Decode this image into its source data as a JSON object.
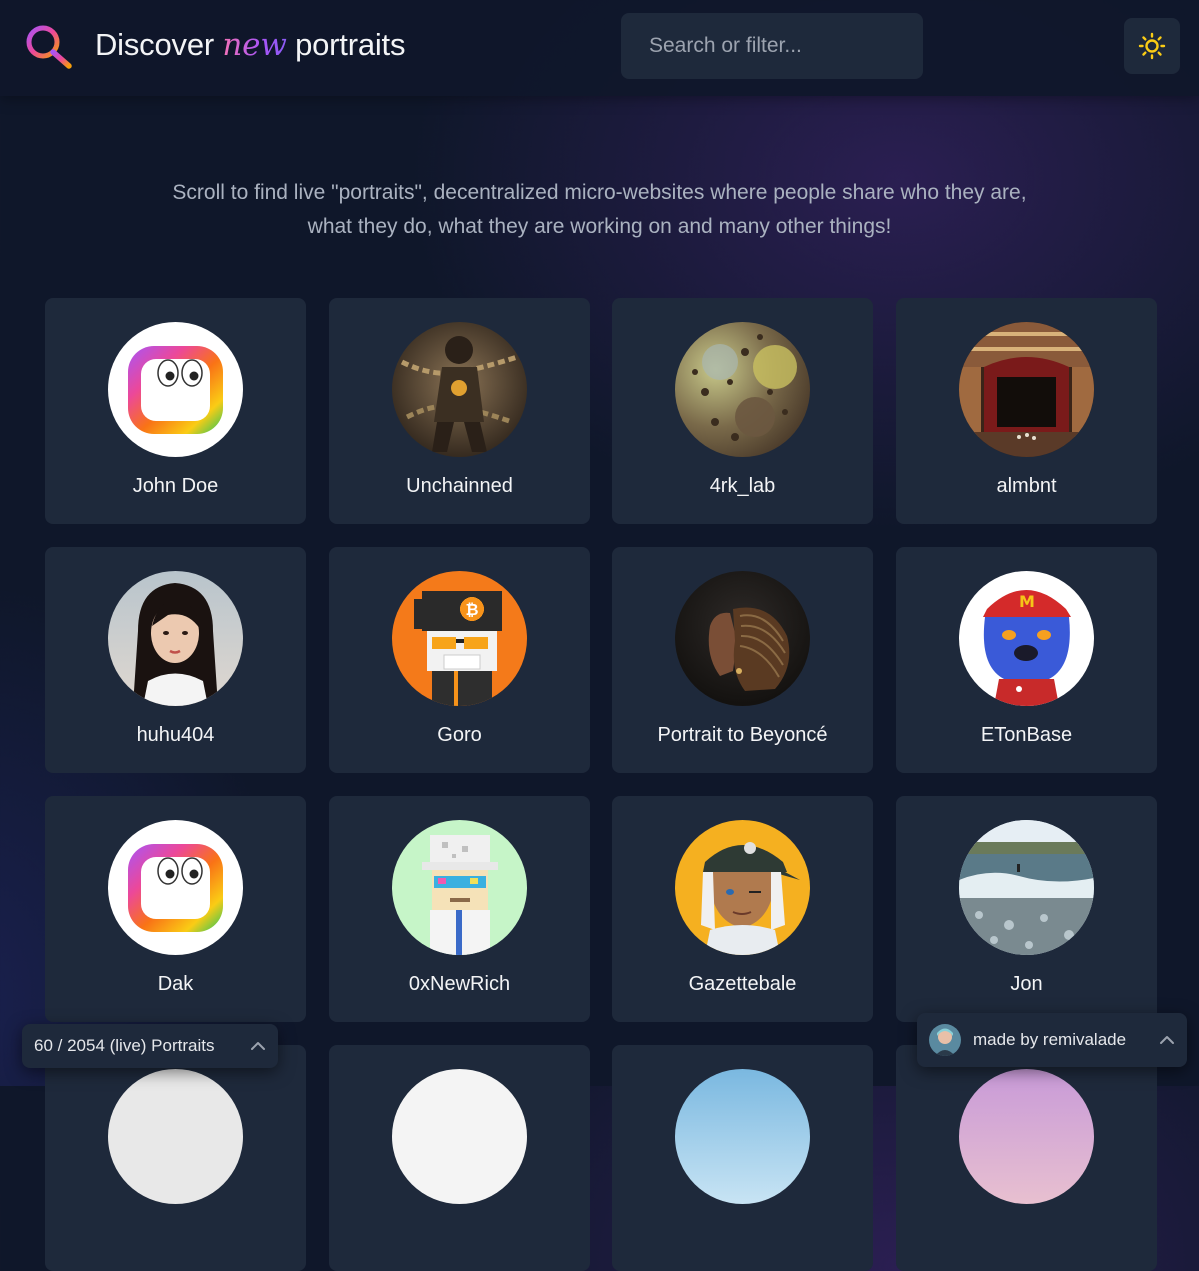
{
  "header": {
    "logo_icon": "search-gradient-icon",
    "title_before": "Discover",
    "title_highlight": "new",
    "title_after": "portraits",
    "search_placeholder": "Search or filter...",
    "theme_toggle_icon": "sun-icon",
    "accent_colors": [
      "#f472b6",
      "#a855f7",
      "#f59e0b"
    ]
  },
  "intro": {
    "line1": "Scroll to find live \"portraits\", decentralized micro-websites where people share who they are,",
    "line2": "what they do, what they are working on and many other things!"
  },
  "portraits": [
    {
      "name": "John Doe",
      "avatar": "colorful-rounded-square-eyes-icon"
    },
    {
      "name": "Unchainned",
      "avatar": "chained-warrior-illustration"
    },
    {
      "name": "4rk_lab",
      "avatar": "microscopic-texture-photo"
    },
    {
      "name": "almbnt",
      "avatar": "opera-theater-photo"
    },
    {
      "name": "huhu404",
      "avatar": "woman-portrait-photo"
    },
    {
      "name": "Goro",
      "avatar": "pixel-art-bitcoin-cap-character"
    },
    {
      "name": "Portrait to Beyoncé",
      "avatar": "braided-hair-profile-photo"
    },
    {
      "name": "ETonBase",
      "avatar": "blue-bulldog-red-cap-illustration"
    },
    {
      "name": "Dak",
      "avatar": "colorful-rounded-square-eyes-icon"
    },
    {
      "name": "0xNewRich",
      "avatar": "pixel-art-character-sunglasses"
    },
    {
      "name": "Gazettebale",
      "avatar": "anime-character-cap-illustration"
    },
    {
      "name": "Jon",
      "avatar": "beach-waves-surfer-photo"
    }
  ],
  "footer": {
    "counter_text": "60 / 2054 (live) Portraits",
    "credit_text": "made by remivalade"
  }
}
